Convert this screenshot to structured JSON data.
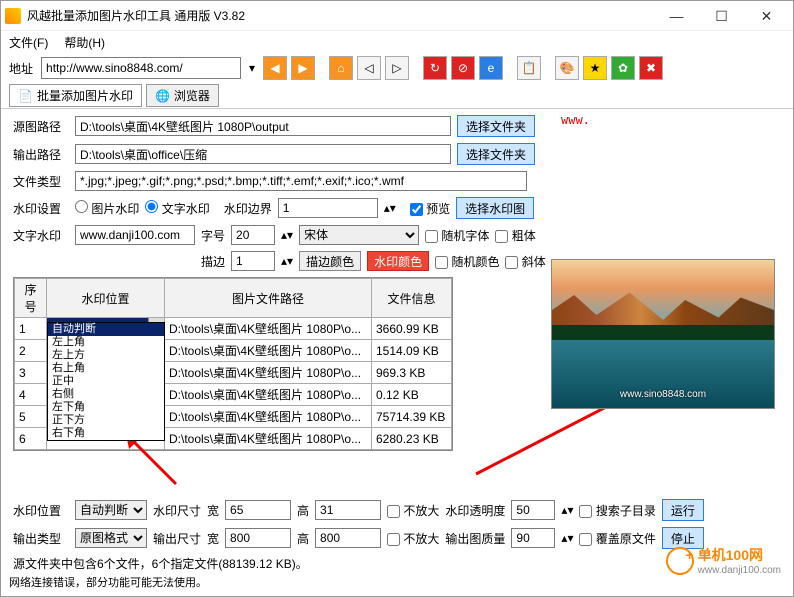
{
  "window": {
    "title": "风越批量添加图片水印工具 通用版 V3.82"
  },
  "menubar": {
    "file": "文件(F)",
    "help": "帮助(H)"
  },
  "addressbar": {
    "label": "地址",
    "url": "http://www.sino8848.com/"
  },
  "tabs": {
    "watermark": "批量添加图片水印",
    "browser": "浏览器"
  },
  "form": {
    "src_label": "源图路径",
    "src_value": "D:\\tools\\桌面\\4K壁纸图片 1080P\\output",
    "browse": "选择文件夹",
    "out_label": "输出路径",
    "out_value": "D:\\tools\\桌面\\office\\压缩",
    "type_label": "文件类型",
    "type_value": "*.jpg;*.jpeg;*.gif;*.png;*.psd;*.bmp;*.tiff;*.emf;*.exif;*.ico;*.wmf",
    "wm_set_label": "水印设置",
    "img_wm": "图片水印",
    "txt_wm": "文字水印",
    "margin_label": "水印边界",
    "margin_val": "1",
    "preview_chk": "预览",
    "choose_wm_img": "选择水印图",
    "txt_wm_label": "文字水印",
    "txt_wm_value": "www.danji100.com",
    "font_size_label": "字号",
    "font_size": "20",
    "font_name": "宋体",
    "rand_font": "随机字体",
    "bold": "粗体",
    "outline_label": "描边",
    "outline_val": "1",
    "outline_color": "描边颜色",
    "wm_color": "水印颜色",
    "rand_color": "随机颜色",
    "italic": "斜体"
  },
  "table": {
    "headers": {
      "idx": "序号",
      "pos": "水印位置",
      "path": "图片文件路径",
      "info": "文件信息"
    },
    "rows": [
      {
        "idx": "1",
        "pos": "自动判断",
        "path": "D:\\tools\\桌面\\4K壁纸图片 1080P\\o...",
        "info": "3660.99 KB"
      },
      {
        "idx": "2",
        "pos": "",
        "path": "D:\\tools\\桌面\\4K壁纸图片 1080P\\o...",
        "info": "1514.09 KB"
      },
      {
        "idx": "3",
        "pos": "",
        "path": "D:\\tools\\桌面\\4K壁纸图片 1080P\\o...",
        "info": "969.3 KB"
      },
      {
        "idx": "4",
        "pos": "",
        "path": "D:\\tools\\桌面\\4K壁纸图片 1080P\\o...",
        "info": "0.12 KB"
      },
      {
        "idx": "5",
        "pos": "",
        "path": "D:\\tools\\桌面\\4K壁纸图片 1080P\\o...",
        "info": "75714.39 KB"
      },
      {
        "idx": "6",
        "pos": "",
        "path": "D:\\tools\\桌面\\4K壁纸图片 1080P\\o...",
        "info": "6280.23 KB"
      }
    ],
    "dropdown_options": [
      "自动判断",
      "左上角",
      "左上方",
      "右上角",
      "正中",
      "右侧",
      "左下角",
      "正下方",
      "右下角"
    ]
  },
  "bottom": {
    "pos_label": "水印位置",
    "pos_val": "自动判断",
    "wm_size_label": "水印尺寸",
    "w_label": "宽",
    "w_val": "65",
    "h_label": "高",
    "h_val": "31",
    "no_enlarge": "不放大",
    "opacity_label": "水印透明度",
    "opacity_val": "50",
    "search_sub": "搜索子目录",
    "run": "运行",
    "out_type_label": "输出类型",
    "out_type_val": "原图格式",
    "out_size_label": "输出尺寸",
    "ow_val": "800",
    "oh_val": "800",
    "quality_label": "输出图质量",
    "quality_val": "90",
    "overwrite": "覆盖原文件",
    "stop": "停止",
    "summary": "源文件夹中包含6个文件，6个指定文件(88139.12 KB)。"
  },
  "preview_wm": "www.sino8848.com",
  "footer": "网络连接错误，部分功能可能无法使用。",
  "logo": {
    "name": "单机100网",
    "sub": "www.danji100.com"
  },
  "www_annotation": "www."
}
